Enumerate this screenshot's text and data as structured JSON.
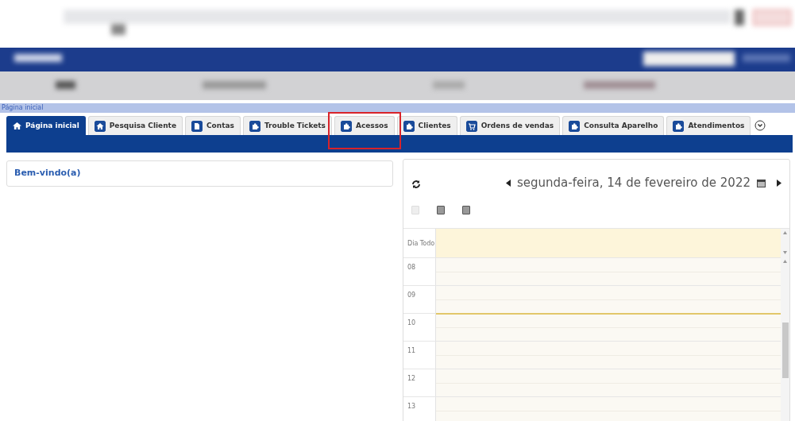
{
  "breadcrumb": "Página inicial",
  "tabs": [
    {
      "label": "Página inicial",
      "kind": "home",
      "selected": true,
      "highlighted": false
    },
    {
      "label": "Pesquisa Cliente",
      "kind": "house",
      "selected": false,
      "highlighted": false
    },
    {
      "label": "Contas",
      "kind": "document",
      "selected": false,
      "highlighted": false
    },
    {
      "label": "Trouble Tickets",
      "kind": "module",
      "selected": false,
      "highlighted": false
    },
    {
      "label": "Acessos",
      "kind": "module",
      "selected": false,
      "highlighted": true
    },
    {
      "label": "Clientes",
      "kind": "module",
      "selected": false,
      "highlighted": false
    },
    {
      "label": "Ordens de vendas",
      "kind": "cart",
      "selected": false,
      "highlighted": false
    },
    {
      "label": "Consulta Aparelho",
      "kind": "module",
      "selected": false,
      "highlighted": false
    },
    {
      "label": "Atendimentos",
      "kind": "module",
      "selected": false,
      "highlighted": false
    }
  ],
  "welcome": {
    "title": "Bem-vindo(a)"
  },
  "calendar": {
    "date": "segunda-feira, 14 de fevereiro de 2022",
    "all_day_label": "Dia Todo",
    "view_buttons": [
      {
        "disabled": true
      },
      {
        "disabled": false
      },
      {
        "disabled": false
      }
    ],
    "hours": [
      {
        "label": "08",
        "current": false
      },
      {
        "label": "09",
        "current": false
      },
      {
        "label": "10",
        "current": true
      },
      {
        "label": "11",
        "current": false
      },
      {
        "label": "12",
        "current": false
      },
      {
        "label": "13",
        "current": false
      }
    ]
  }
}
